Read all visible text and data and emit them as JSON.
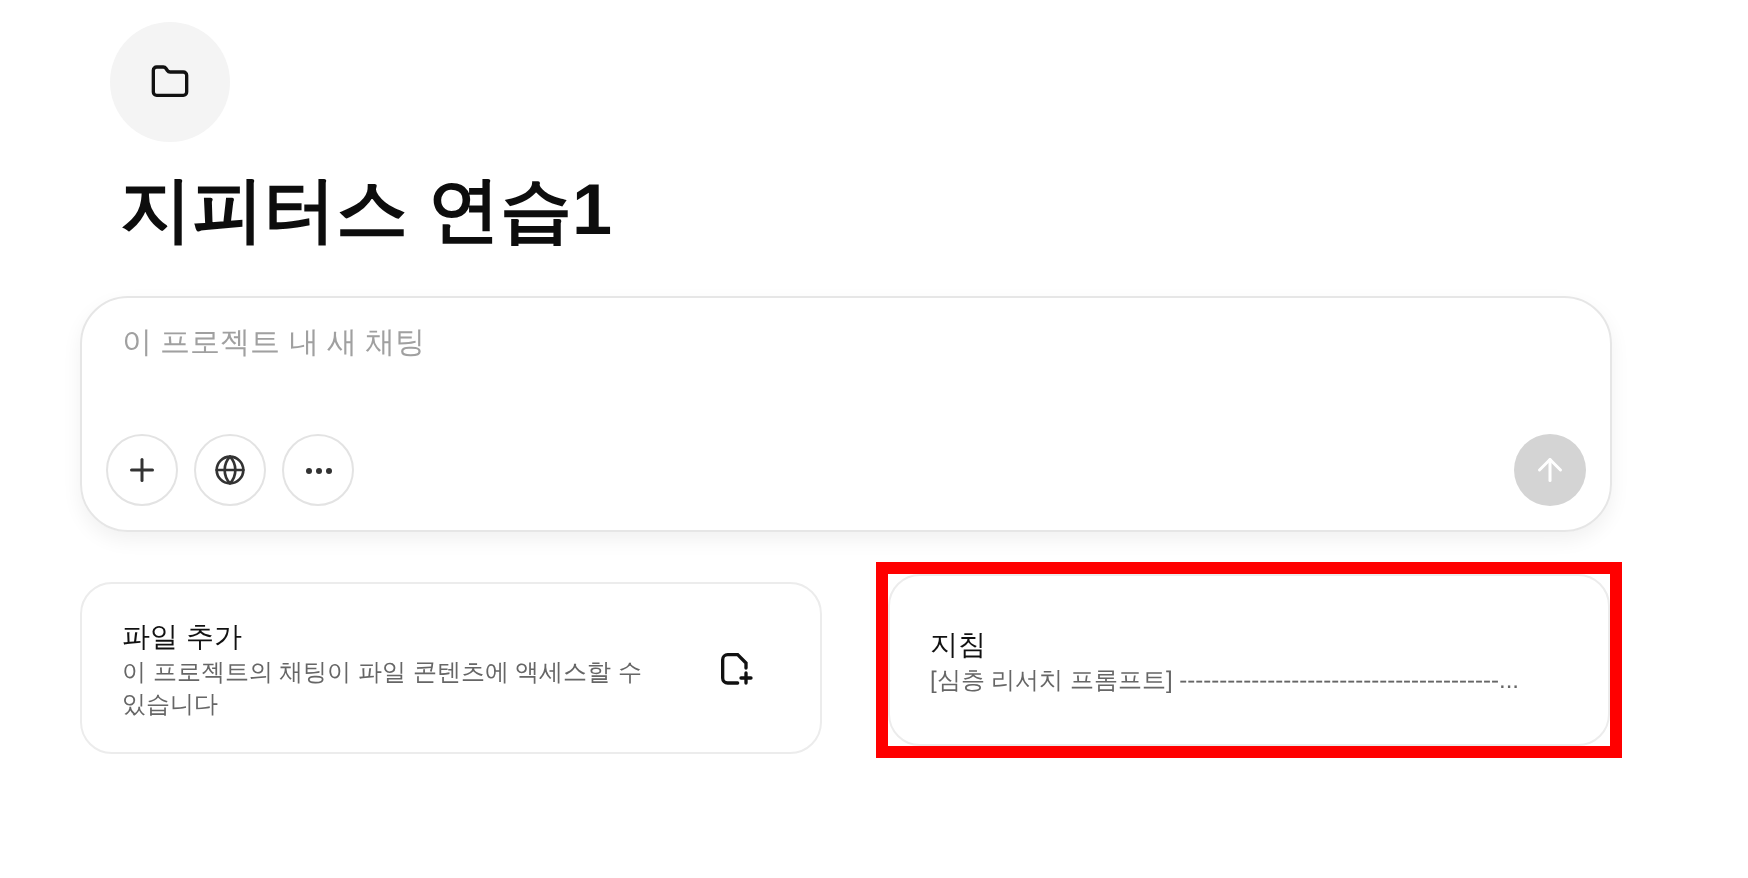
{
  "project": {
    "title": "지피터스 연습1"
  },
  "composer": {
    "placeholder": "이 프로젝트 내 새 채팅"
  },
  "cards": [
    {
      "kind": "files",
      "title": "파일 추가",
      "text": "이 프로젝트의 채팅이 파일 콘텐츠에 액세스할 수 있습니다",
      "highlighted": false
    },
    {
      "kind": "instructions",
      "title": "지침",
      "text": "[심층 리서치 프롬프트] ----------------------------------------...",
      "highlighted": true
    }
  ]
}
